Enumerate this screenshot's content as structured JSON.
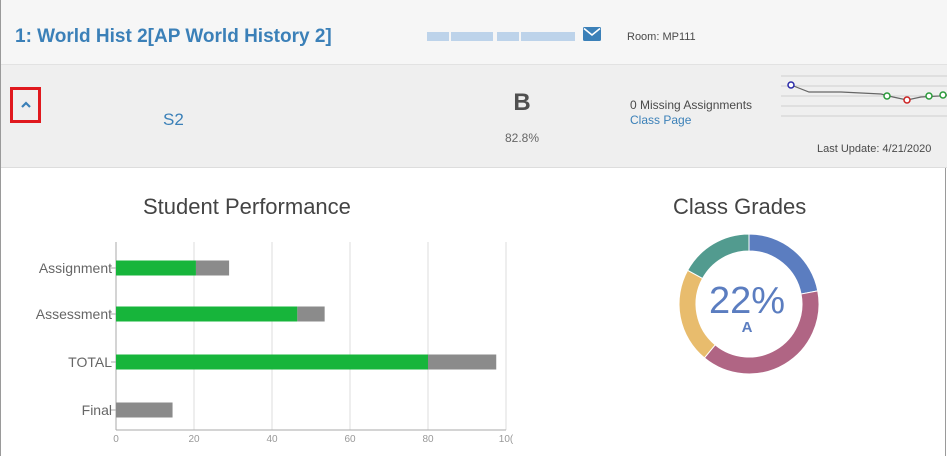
{
  "course": {
    "title": "1: World Hist 2[AP World History 2]",
    "teacher_icon": "mail-icon",
    "room": "Room: MP111"
  },
  "summary": {
    "expand_icon": "chevron-up-icon",
    "term": "S2",
    "grade_letter": "B",
    "grade_percent": "82.8%",
    "missing_assignments": "0 Missing Assignments",
    "class_page_link": "Class Page",
    "last_update": "Last Update: 4/21/2020"
  },
  "student_performance": {
    "title": "Student Performance",
    "chart_data": {
      "type": "bar",
      "orientation": "horizontal",
      "stacked": true,
      "categories": [
        "Assignment",
        "Assessment",
        "TOTAL",
        "Final"
      ],
      "series": [
        {
          "values": [
            20.5,
            46.5,
            80.0,
            0
          ],
          "color": "#17b53b"
        },
        {
          "values": [
            8.5,
            7.0,
            17.5,
            14.5
          ],
          "color": "#8b8b8b"
        }
      ],
      "x_ticks": [
        "0",
        "20",
        "40",
        "60",
        "80",
        "10("
      ],
      "xlim": [
        0,
        100
      ],
      "grid": "vertical"
    }
  },
  "class_grades": {
    "title": "Class Grades",
    "center_percent": "22%",
    "center_grade": "A",
    "chart_data": {
      "type": "pie",
      "donut": true,
      "slices": [
        {
          "value": 22,
          "color": "#5b7dc0"
        },
        {
          "value": 39,
          "color": "#b06584"
        },
        {
          "value": 22,
          "color": "#e8bc6d"
        },
        {
          "value": 17,
          "color": "#529b8f"
        }
      ]
    }
  }
}
